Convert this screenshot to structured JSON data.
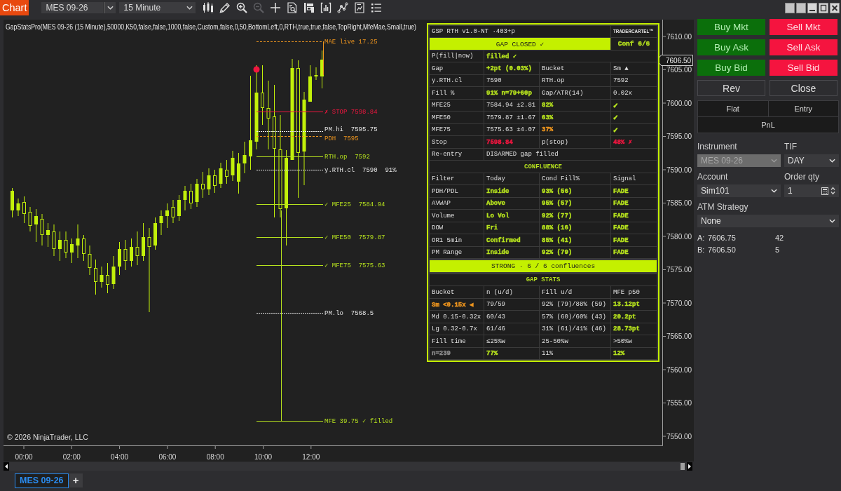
{
  "toolbar": {
    "menu_label": "Chart",
    "instrument": "MES 09-26",
    "interval": "15 Minute",
    "tools": [
      {
        "kind": "data_series",
        "disabled": false
      },
      {
        "kind": "drawing_tools",
        "disabled": false
      },
      {
        "kind": "zoom_in",
        "disabled": false
      },
      {
        "kind": "zoom_out",
        "disabled": true
      },
      {
        "kind": "crosshair",
        "disabled": false
      },
      {
        "kind": "data_box",
        "disabled": false
      },
      {
        "kind": "chart_trader",
        "disabled": false
      },
      {
        "kind": "indicators",
        "disabled": false
      },
      {
        "kind": "strategies",
        "disabled": false
      },
      {
        "kind": "properties",
        "disabled": false
      },
      {
        "kind": "object_list",
        "disabled": false
      }
    ]
  },
  "chart": {
    "indicator_title": "GapStatsPro(MES 09-26 (15 Minute),50000,K50,false,false,1000,false,Custom,false,0,50,BottomLeft,0,RTH,true,true,false,TopRight,MfeMae,Small,true)",
    "price_axis": [
      "7610.00",
      "7605.00",
      "7600.00",
      "7595.00",
      "7590.00",
      "7585.00",
      "7580.00",
      "7575.00",
      "7570.00",
      "7565.00",
      "7560.00",
      "7555.00",
      "7550.00"
    ],
    "last_price": "7606.50",
    "time_axis": [
      "00:00",
      "02:00",
      "04:00",
      "06:00",
      "08:00",
      "10:00",
      "12:00"
    ],
    "levels": [
      {
        "label": "MAE live 17.25",
        "color": "#f0961e",
        "kind": "dashed"
      },
      {
        "label": "✗ STOP 7598.84",
        "color": "#f0163f",
        "kind": "solid"
      },
      {
        "label": "PM.hi  7595.75",
        "color": "#e6e6e6",
        "kind": "dotted"
      },
      {
        "label": "PDH  7595",
        "color": "#f0961e",
        "kind": "dashed"
      },
      {
        "label": "RTH.op  7592",
        "color": "#b6e21e",
        "kind": "solid"
      },
      {
        "label": "y.RTH.cl  7590  91%",
        "color": "#e6e6e6",
        "kind": "dotted"
      },
      {
        "label": "✓ MFE25  7584.94",
        "color": "#b6e21e",
        "kind": "solid"
      },
      {
        "label": "✓ MFE50  7579.87",
        "color": "#b6e21e",
        "kind": "solid"
      },
      {
        "label": "✓ MFE75  7575.63",
        "color": "#b6e21e",
        "kind": "solid"
      },
      {
        "label": "PM.lo  7568.5",
        "color": "#e6e6e6",
        "kind": "dotted"
      },
      {
        "label": "MFE 39.75 ✓ filled",
        "color": "#b6e21e",
        "kind": "solid"
      }
    ],
    "copyright": "© 2026 NinjaTrader, LLC",
    "stats_panel": {
      "rows": [
        {
          "kind": "title",
          "cells": [
            "GSP RTH v1.0-NT ·403+p",
            "TRADERCARTEL™"
          ]
        },
        {
          "kind": "banner",
          "cells": [
            "GAP CLOSED ✓",
            {
              "text": "Conf 6/6",
              "color": "#b6e21e"
            }
          ]
        },
        {
          "kind": "pair",
          "cells": [
            "P(fill|now)",
            {
              "text": "filled ✓",
              "color": "#b6e21e"
            }
          ]
        },
        {
          "kind": "grid",
          "cells": [
            "Gap",
            {
              "text": "+2pt (0.03%)",
              "color": "#b6e21e"
            },
            "Bucket",
            "Sm ▲"
          ]
        },
        {
          "kind": "grid",
          "cells": [
            "y.RTH.cl",
            "7590",
            "RTH.op",
            "7592"
          ]
        },
        {
          "kind": "grid",
          "cells": [
            "Fill %",
            {
              "text": "91% n=79+60p",
              "color": "#b6e21e"
            },
            "Gap/ATR(14)",
            "0.02x"
          ]
        },
        {
          "kind": "grid",
          "cells": [
            "MFE25",
            "7584.94 ±2.81",
            {
              "text": "82%",
              "color": "#b6e21e"
            },
            {
              "text": "✓",
              "color": "#b6e21e"
            }
          ]
        },
        {
          "kind": "grid",
          "cells": [
            "MFE50",
            "7579.87 ±1.67",
            {
              "text": "63%",
              "color": "#b6e21e"
            },
            {
              "text": "✓",
              "color": "#b6e21e"
            }
          ]
        },
        {
          "kind": "grid",
          "cells": [
            "MFE75",
            "7575.63 ±4.07",
            {
              "text": "37%",
              "color": "#f0961e"
            },
            {
              "text": "✓",
              "color": "#b6e21e"
            }
          ]
        },
        {
          "kind": "grid",
          "cells": [
            "Stop",
            {
              "text": "7598.84",
              "color": "#f0163f"
            },
            "p(stop)",
            {
              "text": "48% ✗",
              "color": "#f0163f"
            }
          ]
        },
        {
          "kind": "pair",
          "cells": [
            "Re-entry",
            "DISARMED gap filled"
          ]
        },
        {
          "kind": "section",
          "cells": [
            "CONFLUENCE"
          ]
        },
        {
          "kind": "grid",
          "cells": [
            "Filter",
            "Today",
            "Cond Fill%",
            "Signal"
          ]
        },
        {
          "kind": "grid",
          "cells": [
            "PDH/PDL",
            {
              "text": "Inside",
              "color": "#b6e21e"
            },
            {
              "text": "93% (56)",
              "color": "#b6e21e"
            },
            {
              "text": "FADE",
              "color": "#b6e21e"
            }
          ]
        },
        {
          "kind": "grid",
          "cells": [
            "AVWAP",
            {
              "text": "Above",
              "color": "#b6e21e"
            },
            {
              "text": "95% (57)",
              "color": "#b6e21e"
            },
            {
              "text": "FADE",
              "color": "#b6e21e"
            }
          ]
        },
        {
          "kind": "grid",
          "cells": [
            "Volume",
            {
              "text": "Lo Vol",
              "color": "#b6e21e"
            },
            {
              "text": "92% (77)",
              "color": "#b6e21e"
            },
            {
              "text": "FADE",
              "color": "#b6e21e"
            }
          ]
        },
        {
          "kind": "grid",
          "cells": [
            "DOW",
            {
              "text": "Fri",
              "color": "#b6e21e"
            },
            {
              "text": "88% (16)",
              "color": "#b6e21e"
            },
            {
              "text": "FADE",
              "color": "#b6e21e"
            }
          ]
        },
        {
          "kind": "grid",
          "cells": [
            "OR1 5min",
            {
              "text": "Confirmed",
              "color": "#b6e21e"
            },
            {
              "text": "85% (41)",
              "color": "#b6e21e"
            },
            {
              "text": "FADE",
              "color": "#b6e21e"
            }
          ]
        },
        {
          "kind": "grid",
          "cells": [
            "PM Range",
            {
              "text": "Inside",
              "color": "#b6e21e"
            },
            {
              "text": "92% (79)",
              "color": "#b6e21e"
            },
            {
              "text": "FADE",
              "color": "#b6e21e"
            }
          ]
        },
        {
          "kind": "band",
          "cells": [
            "STRONG · 6 / 6 confluences"
          ]
        },
        {
          "kind": "section",
          "cells": [
            "GAP STATS"
          ]
        },
        {
          "kind": "grid",
          "cells": [
            "Bucket",
            "n (u/d)",
            "Fill u/d",
            "MFE p50"
          ]
        },
        {
          "kind": "grid",
          "cells": [
            {
              "text": "Sm <0.15x ◀",
              "color": "#f0961e"
            },
            "79/59",
            "92% (79)/88% (59)",
            {
              "text": "13.12pt",
              "color": "#b6e21e"
            }
          ]
        },
        {
          "kind": "grid",
          "cells": [
            "Md 0.15-0.32x",
            "60/43",
            "57% (60)/60% (43)",
            {
              "text": "20.2pt",
              "color": "#b6e21e"
            }
          ]
        },
        {
          "kind": "grid",
          "cells": [
            "Lg 0.32-0.7x",
            "61/46",
            "31% (61)/41% (46)",
            {
              "text": "28.73pt",
              "color": "#b6e21e"
            }
          ]
        },
        {
          "kind": "grid",
          "cells": [
            "Fill time",
            "≤25%w",
            "25-50%w",
            ">50%w"
          ]
        },
        {
          "kind": "grid",
          "cells": [
            {
              "text": "n=239",
              "color": "#8a8a8a"
            },
            {
              "text": "77%",
              "color": "#b6e21e"
            },
            "11%",
            {
              "text": "12%",
              "color": "#b6e21e"
            }
          ]
        }
      ]
    }
  },
  "order_panel": {
    "buttons": [
      {
        "label": "Buy Mkt",
        "kind": "buy"
      },
      {
        "label": "Sell Mkt",
        "kind": "sell"
      },
      {
        "label": "Buy Ask",
        "kind": "buy"
      },
      {
        "label": "Sell Ask",
        "kind": "sell"
      },
      {
        "label": "Buy Bid",
        "kind": "buy"
      },
      {
        "label": "Sell Bid",
        "kind": "sell"
      },
      {
        "label": "Rev",
        "kind": "neutral"
      },
      {
        "label": "Close",
        "kind": "neutral"
      }
    ],
    "position": {
      "cells": [
        "Flat",
        "Entry",
        "PnL"
      ]
    },
    "fields": [
      {
        "label": "Instrument",
        "value": "MES 09-26",
        "kind": "combo",
        "disabled": true
      },
      {
        "label": "TIF",
        "value": "DAY",
        "kind": "combo",
        "disabled": false
      },
      {
        "label": "Account",
        "value": "Sim101",
        "kind": "combo",
        "disabled": false
      },
      {
        "label": "Order qty",
        "value": "1",
        "kind": "spinner",
        "disabled": false
      },
      {
        "label": "ATM Strategy",
        "value": "None",
        "kind": "combo",
        "disabled": false
      }
    ],
    "quotes": [
      {
        "side": "A:",
        "price": "7606.75",
        "size": "42"
      },
      {
        "side": "B:",
        "price": "7606.50",
        "size": "5"
      }
    ]
  },
  "tabs": {
    "items": [
      {
        "label": "MES 09-26",
        "selected": true
      }
    ],
    "add_label": "+"
  }
}
